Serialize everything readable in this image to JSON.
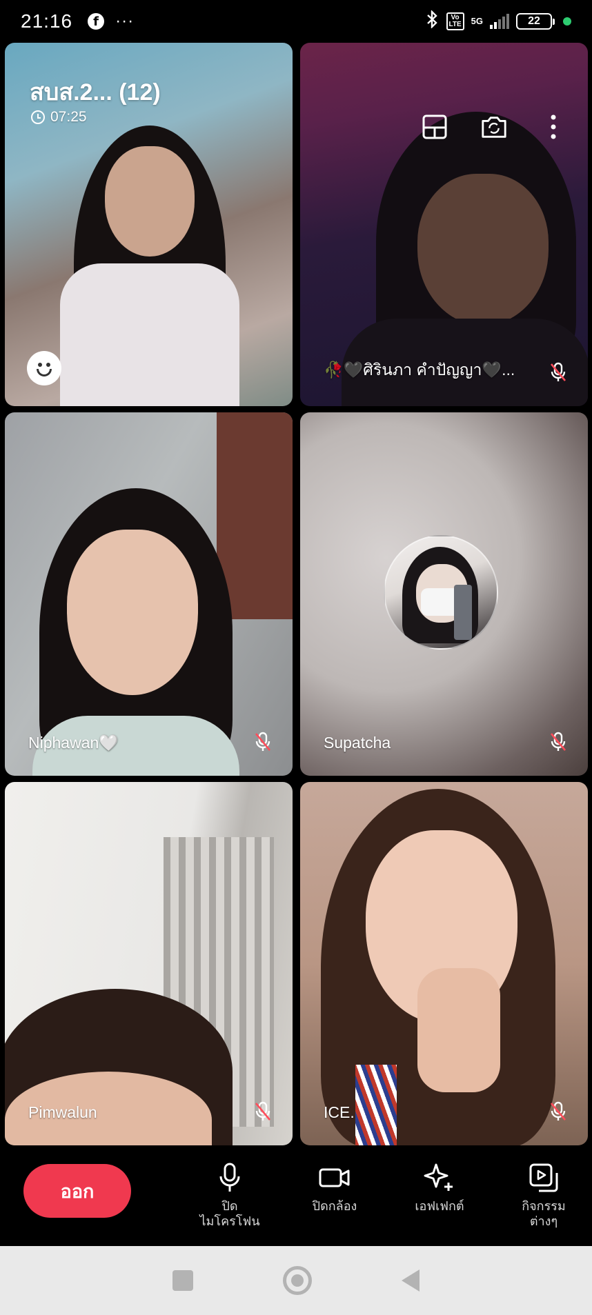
{
  "status_bar": {
    "time": "21:16",
    "app_icon": "facebook-icon",
    "overflow": "···",
    "network_label": "5G",
    "volte_label": "Vo\nLTE",
    "battery": "22"
  },
  "call": {
    "title": "สบส.2... (12)",
    "timer": "07:25"
  },
  "participants": [
    {
      "name": "",
      "mic_muted": false
    },
    {
      "name": "🥀🖤ศิรินภา คำปัญญา🖤...",
      "mic_muted": true
    },
    {
      "name": "Niphawan🤍",
      "mic_muted": true
    },
    {
      "name": "Supatcha",
      "mic_muted": true,
      "camera_off": true
    },
    {
      "name": "Pimwalun",
      "mic_muted": true
    },
    {
      "name": "ICE.",
      "mic_muted": true
    }
  ],
  "controls": {
    "leave_label": "ออก",
    "mic_label": "ปิด\nไมโครโฟน",
    "camera_label": "ปิดกล้อง",
    "effects_label": "เอฟเฟกต์",
    "activities_label": "กิจกรรม\nต่างๆ"
  },
  "colors": {
    "leave_button": "#f0394f",
    "background": "#000000",
    "navbar": "#e9e9e9"
  }
}
